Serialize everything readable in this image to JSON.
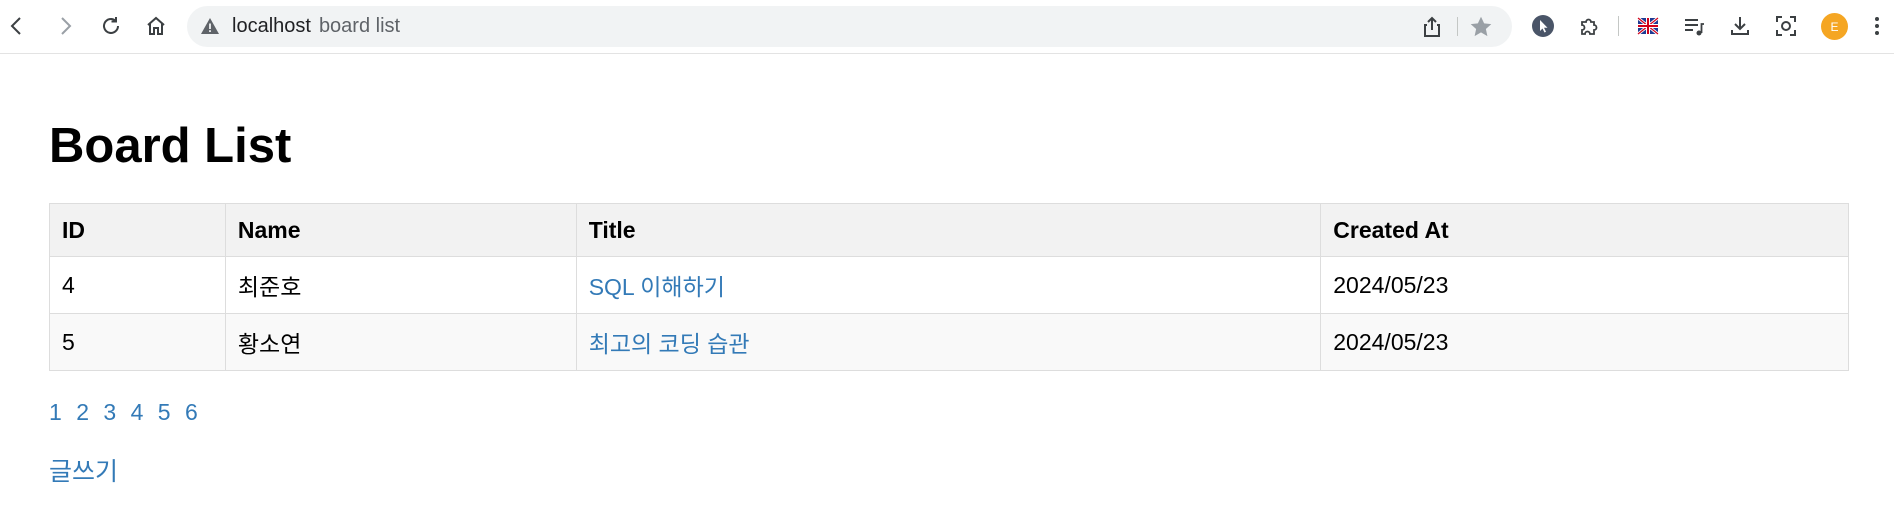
{
  "browser": {
    "url_host": "localhost",
    "url_path": "board list",
    "avatar_letter": "E"
  },
  "page": {
    "title": "Board List",
    "columns": [
      "ID",
      "Name",
      "Title",
      "Created At"
    ],
    "rows": [
      {
        "id": "4",
        "name": "최준호",
        "title": "SQL 이해하기",
        "created_at": "2024/05/23"
      },
      {
        "id": "5",
        "name": "황소연",
        "title": "최고의 코딩 습관",
        "created_at": "2024/05/23"
      }
    ],
    "pages": [
      "1",
      "2",
      "3",
      "4",
      "5",
      "6"
    ],
    "write_link": "글쓰기"
  },
  "colors": {
    "link": "#337ab7",
    "header_bg": "#f2f2f2",
    "row_alt_bg": "#f9f9f9",
    "avatar_bg": "#f5a623"
  }
}
